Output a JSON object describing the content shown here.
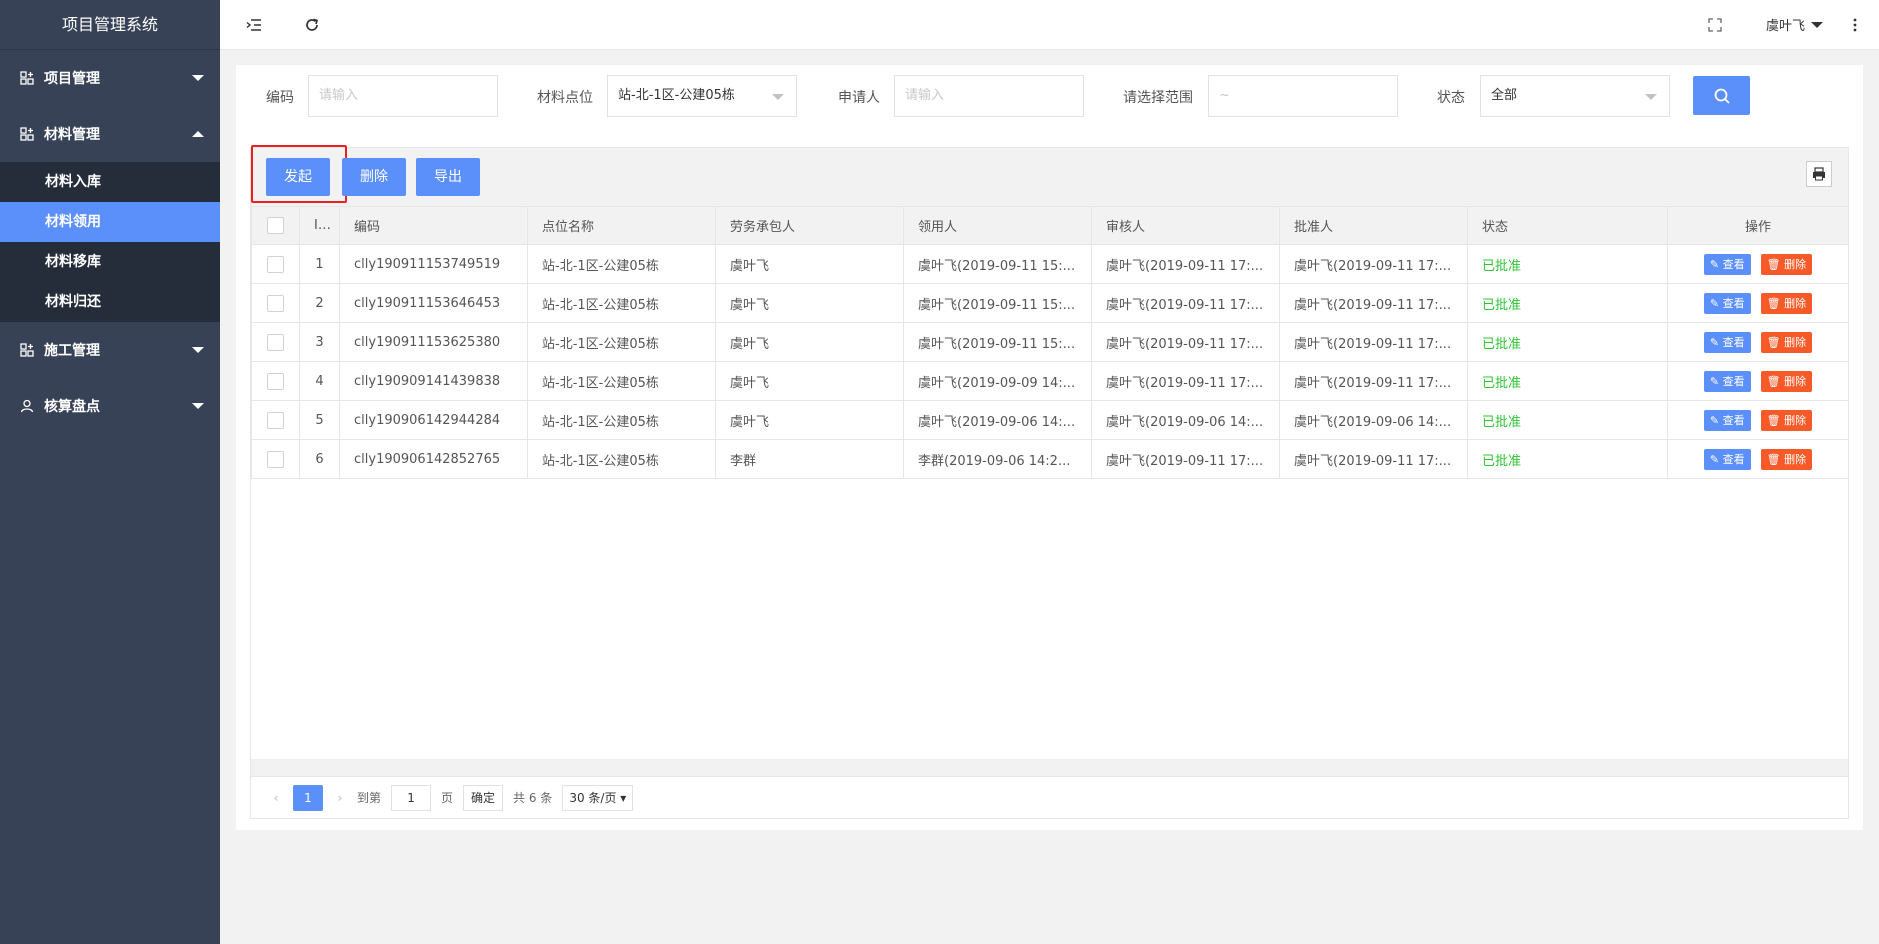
{
  "app": {
    "title": "项目管理系统"
  },
  "sidebar": {
    "groups": [
      {
        "label": "项目管理",
        "expanded": false,
        "icon": "grid-icon"
      },
      {
        "label": "材料管理",
        "expanded": true,
        "icon": "grid-icon",
        "items": [
          {
            "label": "材料入库",
            "active": false
          },
          {
            "label": "材料领用",
            "active": true
          },
          {
            "label": "材料移库",
            "active": false
          },
          {
            "label": "材料归还",
            "active": false
          }
        ]
      },
      {
        "label": "施工管理",
        "expanded": false,
        "icon": "grid-icon"
      },
      {
        "label": "核算盘点",
        "expanded": false,
        "icon": "user-icon"
      }
    ]
  },
  "topbar": {
    "user": "虞叶飞"
  },
  "filters": {
    "code_label": "编码",
    "code_placeholder": "请输入",
    "location_label": "材料点位",
    "location_value": "站-北-1区-公建05栋",
    "applicant_label": "申请人",
    "applicant_placeholder": "请输入",
    "range_label": "请选择范围",
    "range_placeholder": "~",
    "status_label": "状态",
    "status_value": "全部"
  },
  "toolbar": {
    "start_label": "发起",
    "delete_label": "删除",
    "export_label": "导出"
  },
  "table": {
    "headers": [
      "ID",
      "编码",
      "点位名称",
      "劳务承包人",
      "领用人",
      "审核人",
      "批准人",
      "状态",
      "操作"
    ],
    "view_label": "查看",
    "delete_label": "删除",
    "rows": [
      {
        "id": "1",
        "code": "clly190911153749519",
        "location": "站-北-1区-公建05栋",
        "contractor": "虞叶飞",
        "receiver": "虞叶飞(2019-09-11 15:...",
        "reviewer": "虞叶飞(2019-09-11 17:...",
        "approver": "虞叶飞(2019-09-11 17:...",
        "status": "已批准"
      },
      {
        "id": "2",
        "code": "clly190911153646453",
        "location": "站-北-1区-公建05栋",
        "contractor": "虞叶飞",
        "receiver": "虞叶飞(2019-09-11 15:...",
        "reviewer": "虞叶飞(2019-09-11 17:...",
        "approver": "虞叶飞(2019-09-11 17:...",
        "status": "已批准"
      },
      {
        "id": "3",
        "code": "clly190911153625380",
        "location": "站-北-1区-公建05栋",
        "contractor": "虞叶飞",
        "receiver": "虞叶飞(2019-09-11 15:...",
        "reviewer": "虞叶飞(2019-09-11 17:...",
        "approver": "虞叶飞(2019-09-11 17:...",
        "status": "已批准"
      },
      {
        "id": "4",
        "code": "clly190909141439838",
        "location": "站-北-1区-公建05栋",
        "contractor": "虞叶飞",
        "receiver": "虞叶飞(2019-09-09 14:...",
        "reviewer": "虞叶飞(2019-09-11 17:...",
        "approver": "虞叶飞(2019-09-11 17:...",
        "status": "已批准"
      },
      {
        "id": "5",
        "code": "clly190906142944284",
        "location": "站-北-1区-公建05栋",
        "contractor": "虞叶飞",
        "receiver": "虞叶飞(2019-09-06 14:...",
        "reviewer": "虞叶飞(2019-09-06 14:...",
        "approver": "虞叶飞(2019-09-06 14:...",
        "status": "已批准"
      },
      {
        "id": "6",
        "code": "clly190906142852765",
        "location": "站-北-1区-公建05栋",
        "contractor": "李群",
        "receiver": "李群(2019-09-06 14:2...",
        "reviewer": "虞叶飞(2019-09-11 17:...",
        "approver": "虞叶飞(2019-09-11 17:...",
        "status": "已批准"
      }
    ]
  },
  "pager": {
    "current": "1",
    "goto_label": "到第",
    "goto_value": "1",
    "page_unit": "页",
    "confirm_label": "确定",
    "total_label": "共 6 条",
    "page_size": "30 条/页"
  },
  "colors": {
    "primary": "#5b8ff9",
    "danger": "#f65a29",
    "success": "#2ec433",
    "sidebar": "#384257"
  }
}
